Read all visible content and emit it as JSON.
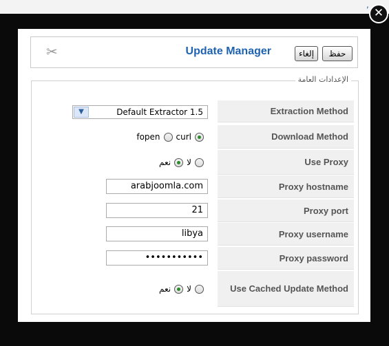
{
  "modal": {
    "title": "Update Manager",
    "save_label": "حفظ",
    "cancel_label": "إلغاء",
    "close_icon": "close-icon",
    "tool_icon": "tools-icon"
  },
  "fieldset": {
    "legend": "الإعدادات العامة"
  },
  "form": {
    "extraction_method": {
      "label": "Extraction Method",
      "value": "Default Extractor 1.5"
    },
    "download_method": {
      "label": "Download Method",
      "option_fopen": "fopen",
      "option_curl": "curl",
      "selected": "curl"
    },
    "use_proxy": {
      "label": "Use Proxy",
      "yes": "نعم",
      "no": "لا",
      "selected": "no"
    },
    "proxy_hostname": {
      "label": "Proxy hostname",
      "value": "arabjoomla.com"
    },
    "proxy_port": {
      "label": "Proxy port",
      "value": "21"
    },
    "proxy_username": {
      "label": "Proxy username",
      "value": "libya"
    },
    "proxy_password": {
      "label": "Proxy password",
      "value": "•••••••••••"
    },
    "use_cached": {
      "label": "Use Cached Update Method",
      "yes": "نعم",
      "no": "لا",
      "selected": "no"
    }
  }
}
